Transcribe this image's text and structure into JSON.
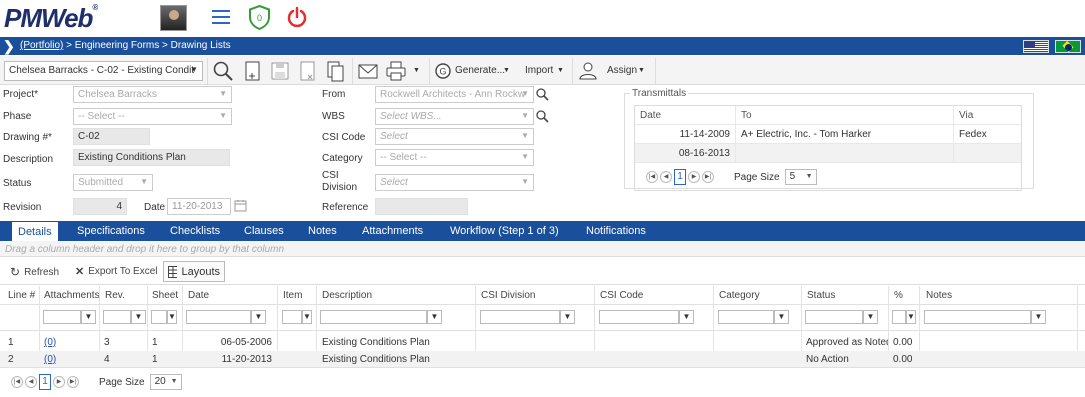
{
  "app": {
    "logo_text": "PMWeb",
    "logo_mark": "®",
    "notification_count": "0"
  },
  "breadcrumb": {
    "root": "(Portfolio)",
    "trail": " > Engineering Forms > Drawing Lists"
  },
  "toolbar": {
    "record_selector": "Chelsea Barracks - C-02 - Existing Condit",
    "generate_label": "Generate...",
    "import_label": "Import",
    "assign_label": "Assign"
  },
  "form": {
    "project_label": "Project*",
    "project_value": "Chelsea Barracks",
    "phase_label": "Phase",
    "phase_value": "-- Select --",
    "drawing_label": "Drawing #*",
    "drawing_value": "C-02",
    "description_label": "Description",
    "description_value": "Existing Conditions Plan",
    "status_label": "Status",
    "status_value": "Submitted",
    "revision_label": "Revision",
    "revision_value": "4",
    "date_label": "Date",
    "date_value": "11-20-2013",
    "from_label": "From",
    "from_value": "Rockwell Architects - Ann Rockw",
    "wbs_label": "WBS",
    "wbs_placeholder": "Select WBS...",
    "csi_code_label": "CSI Code",
    "csi_code_placeholder": "Select",
    "category_label": "Category",
    "category_value": "-- Select --",
    "csi_division_label_1": "CSI",
    "csi_division_label_2": "Division",
    "csi_division_placeholder": "Select",
    "reference_label": "Reference",
    "reference_value": ""
  },
  "transmittals": {
    "title": "Transmittals",
    "columns": [
      "Date",
      "To",
      "Via"
    ],
    "rows": [
      {
        "date": "11-14-2009",
        "to": "A+ Electric, Inc. - Tom Harker",
        "via": "Fedex"
      },
      {
        "date": "08-16-2013",
        "to": "",
        "via": ""
      }
    ],
    "page": "1",
    "page_size_label": "Page Size",
    "page_size": "5"
  },
  "tabs": [
    "Details",
    "Specifications",
    "Checklists",
    "Clauses",
    "Notes",
    "Attachments",
    "Workflow (Step 1 of 3)",
    "Notifications"
  ],
  "grid": {
    "group_hint": "Drag a column header and drop it here to group by that column",
    "refresh_label": "Refresh",
    "export_label": "Export To Excel",
    "layouts_label": "Layouts",
    "columns": [
      "Line #",
      "Attachments",
      "Rev.",
      "Sheet",
      "Date",
      "Item",
      "Description",
      "CSI Division",
      "CSI Code",
      "Category",
      "Status",
      "%",
      "Notes"
    ],
    "rows": [
      {
        "line": "1",
        "attachments": "(0)",
        "rev": "3",
        "sheet": "1",
        "date": "06-05-2006",
        "item": "",
        "description": "Existing Conditions Plan",
        "csi_division": "",
        "csi_code": "",
        "category": "",
        "status": "Approved as Noted",
        "pct": "0.00",
        "notes": ""
      },
      {
        "line": "2",
        "attachments": "(0)",
        "rev": "4",
        "sheet": "1",
        "date": "11-20-2013",
        "item": "",
        "description": "Existing Conditions Plan",
        "csi_division": "",
        "csi_code": "",
        "category": "",
        "status": "No Action",
        "pct": "0.00",
        "notes": ""
      }
    ],
    "page": "1",
    "page_size_label": "Page Size",
    "page_size": "20"
  },
  "colors": {
    "brand_blue": "#1a4f9c",
    "logo_navy": "#1f2f6b",
    "power_red": "#e03030",
    "shield_green": "#3a9a3a"
  }
}
